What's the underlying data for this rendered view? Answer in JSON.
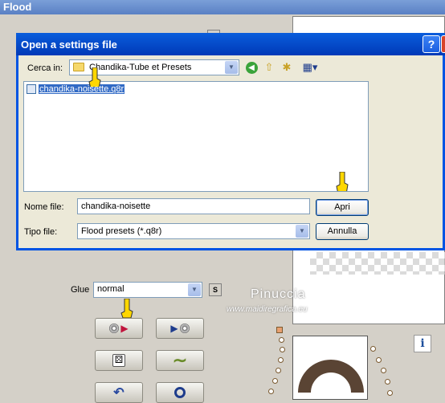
{
  "flood_window": {
    "title": "Flood",
    "glue_label": "Glue",
    "glue_value": "normal",
    "s_label": "S",
    "info_label": "i"
  },
  "watermark": {
    "title": "Pinuccia",
    "url": "www.maidiregrafica.eu"
  },
  "dialog": {
    "title": "Open a settings file",
    "help_label": "?",
    "look_in_label": "Cerca in:",
    "look_in_value": "Chandika-Tube et Presets",
    "files": [
      {
        "name": "chandika-noisette.q8r",
        "selected": true
      }
    ],
    "file_name_label": "Nome file:",
    "file_name_value": "chandika-noisette",
    "file_type_label": "Tipo file:",
    "file_type_value": "Flood presets (*.q8r)",
    "open_label": "Apri",
    "cancel_label": "Annulla"
  },
  "colors": {
    "titlebar": "#0054e3",
    "selection": "#316ac5",
    "window_bg": "#d4d0c8",
    "dialog_bg": "#ece9d8"
  }
}
